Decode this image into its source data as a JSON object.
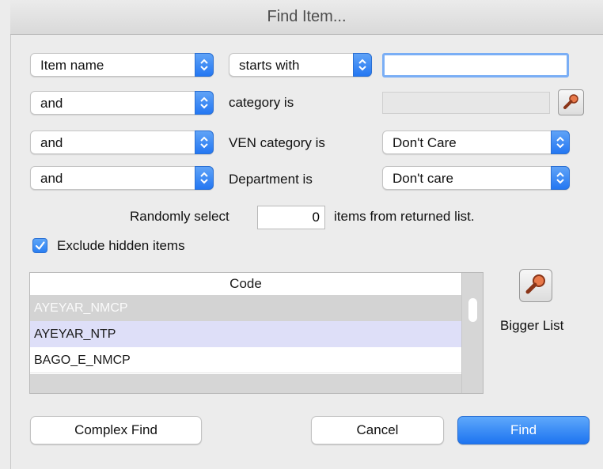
{
  "window": {
    "title": "Find Item..."
  },
  "criteria": [
    {
      "selector": "Item name",
      "operator": "starts with",
      "value": ""
    },
    {
      "selector": "and",
      "label": "category is",
      "value": ""
    },
    {
      "selector": "and",
      "label": "VEN category is",
      "choice": "Don't Care"
    },
    {
      "selector": "and",
      "label": "Department is",
      "choice": "Don't care"
    }
  ],
  "random": {
    "prefix": "Randomly select",
    "value": "0",
    "suffix": "items from returned list."
  },
  "exclude_hidden": {
    "label": "Exclude hidden items",
    "checked": true
  },
  "table": {
    "header": "Code",
    "rows": [
      "AYEYAR_NMCP",
      "AYEYAR_NTP",
      "BAGO_E_NMCP"
    ]
  },
  "bigger_list": {
    "label": "Bigger List",
    "icon": "magnifier-icon"
  },
  "buttons": {
    "complex_find": "Complex Find",
    "cancel": "Cancel",
    "find": "Find"
  },
  "colors": {
    "accent": "#2477f2",
    "selected_row": "#dedff8",
    "dimmed_row": "#d3d3d3"
  }
}
